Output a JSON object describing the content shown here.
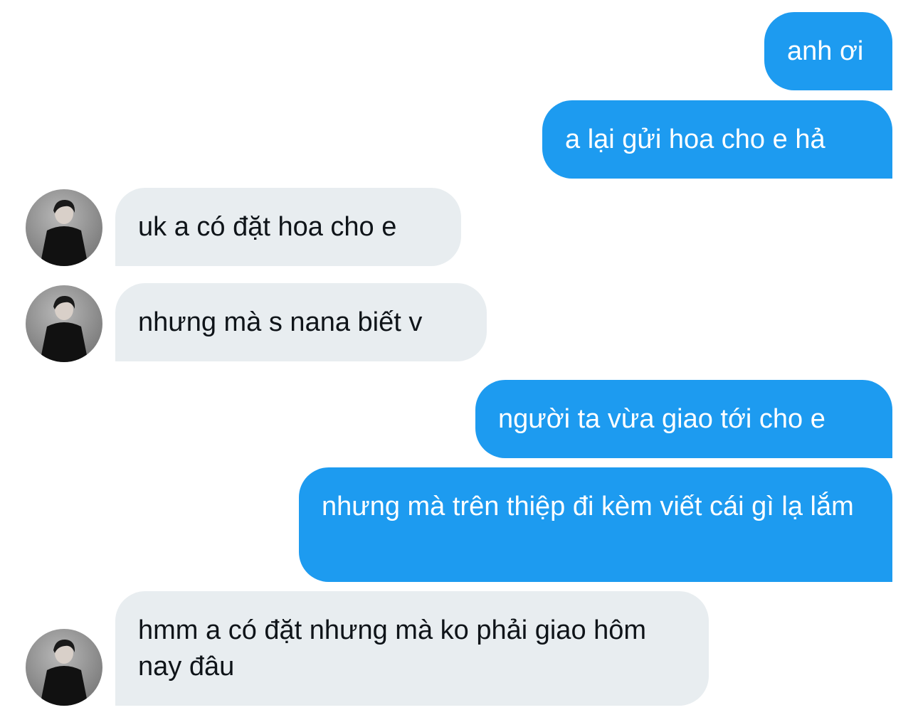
{
  "messages": [
    {
      "id": "m1",
      "direction": "outgoing",
      "text": "anh ơi"
    },
    {
      "id": "m2",
      "direction": "outgoing",
      "text": "a lại gửi hoa cho e hả"
    },
    {
      "id": "m3",
      "direction": "incoming",
      "text": "uk a có đặt hoa cho e"
    },
    {
      "id": "m4",
      "direction": "incoming",
      "text": "nhưng mà s nana biết v"
    },
    {
      "id": "m5",
      "direction": "outgoing",
      "text": "người ta vừa giao tới cho e"
    },
    {
      "id": "m6",
      "direction": "outgoing",
      "text": "nhưng mà trên thiệp đi kèm viết cái gì lạ lắm"
    },
    {
      "id": "m7",
      "direction": "incoming",
      "text": "hmm a có đặt nhưng mà ko phải giao hôm nay đâu"
    }
  ],
  "colors": {
    "outgoing_bubble": "#1d9bf0",
    "incoming_bubble": "#e8edf0",
    "outgoing_text": "#ffffff",
    "incoming_text": "#0f1419"
  },
  "icons": {
    "avatar": "contact-avatar-photo"
  }
}
